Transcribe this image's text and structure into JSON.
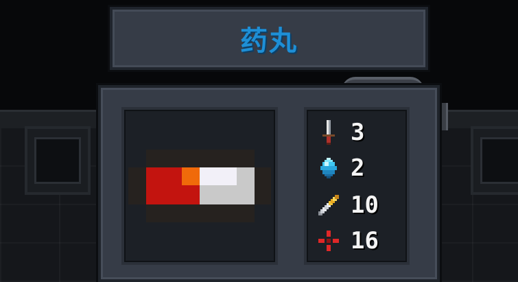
{
  "item": {
    "name": "药丸",
    "name_color": "#1e8fd6",
    "sprite_icon": "pill-icon",
    "sprite_colors": {
      "red": "#c3140f",
      "orange": "#f06a0a",
      "white": "#f2f0f8",
      "grey": "#c9c9c9"
    }
  },
  "stats": [
    {
      "icon": "sword-icon",
      "value": "3"
    },
    {
      "icon": "crystal-icon",
      "value": "2"
    },
    {
      "icon": "bullet-icon",
      "value": "10"
    },
    {
      "icon": "crosshair-icon",
      "value": "16"
    }
  ]
}
